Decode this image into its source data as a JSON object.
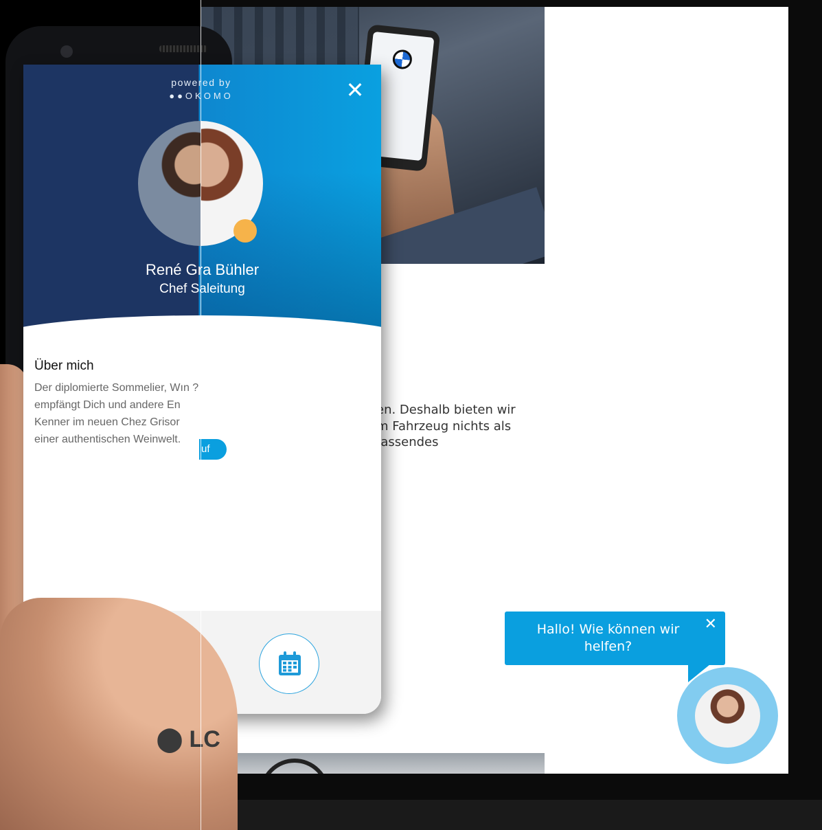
{
  "widget": {
    "powered_by": "powered by",
    "brand": "●●OKOMO",
    "close_glyph": "✕",
    "profile": {
      "name": "René Gra Bühler",
      "role": "Chef Saleitung"
    },
    "about": {
      "heading": "Über mich",
      "lines": [
        "Der diplomierte Sommelier, Wın ?",
        "empfängt Dich und andere En",
        "Kenner im neuen Chez Grisor",
        "einer authentischen Weinwelt."
      ],
      "read_more": "uf"
    }
  },
  "device": {
    "brand": "⬤ LC"
  },
  "website": {
    "body_lines": [
      "en. Deshalb bieten wir",
      "m Fahrzeug nichts als",
      "fassendes"
    ],
    "footer_text": "O",
    "chat": {
      "message": "Hallo! Wie können wir helfen?",
      "close_glyph": "✕"
    }
  },
  "colors": {
    "header_dark": "#1d3563",
    "header_blue": "#0aa0e0",
    "chat_blue": "#0a9fdf",
    "chat_ring": "#82ccf0",
    "status_dot": "#f6b34a"
  }
}
